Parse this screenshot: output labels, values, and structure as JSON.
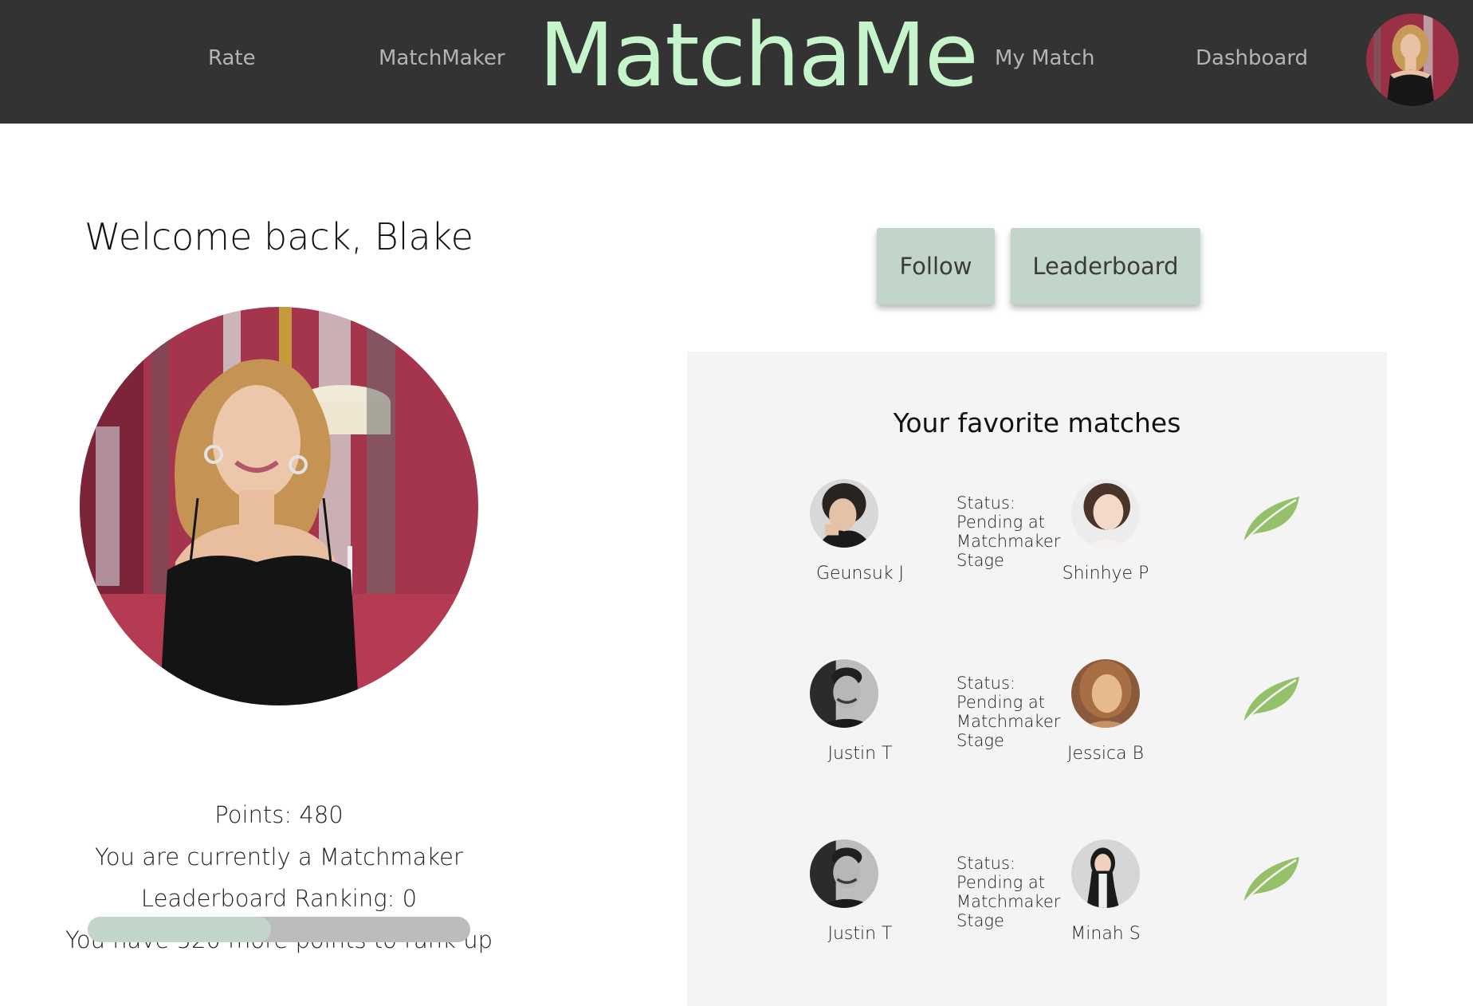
{
  "nav": {
    "rate": "Rate",
    "matchmaker": "MatchMaker",
    "logo": "MatchaMe",
    "my_match": "My Match",
    "dashboard": "Dashboard"
  },
  "profile": {
    "welcome": "Welcome back, Blake",
    "points": "Points: 480",
    "role": "You are currently a Matchmaker",
    "ranking": "Leaderboard Ranking: 0",
    "rank_up": "You have 520 more points to rank up",
    "progress_fraction": 0.48
  },
  "actions": {
    "follow": "Follow",
    "leaderboard": "Leaderboard"
  },
  "favorites": {
    "title": "Your favorite matches",
    "matches": [
      {
        "left_name": "Geunsuk J",
        "status_line1": "Status:",
        "status_line2": "Pending at",
        "status_line3": "Matchmaker",
        "status_line4": "Stage",
        "right_name": "Shinhye P"
      },
      {
        "left_name": "Justin T",
        "status_line1": "Status:",
        "status_line2": "Pending at",
        "status_line3": "Matchmaker",
        "status_line4": "Stage",
        "right_name": "Jessica B"
      },
      {
        "left_name": "Justin T",
        "status_line1": "Status:",
        "status_line2": "Pending at",
        "status_line3": "Matchmaker",
        "status_line4": "Stage",
        "right_name": "Minah S"
      }
    ]
  },
  "colors": {
    "header_bg": "#333333",
    "logo": "#c6f5cc",
    "nav_text": "#b4b4b4",
    "button_bg": "#c1d5c8",
    "progress_fill": "#c1d5c8",
    "progress_track": "#bcbcbc",
    "panel_bg": "#f4f4f4",
    "leaf": "#94c06a"
  },
  "icons": {
    "favorite": "leaf-icon"
  }
}
